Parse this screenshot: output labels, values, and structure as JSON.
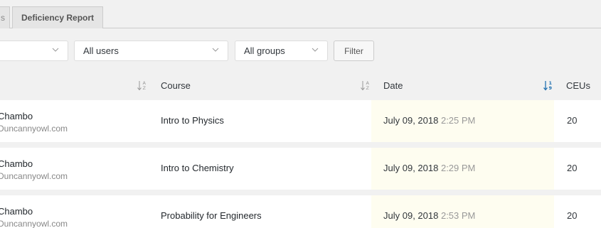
{
  "tabs": {
    "prev_label": "s",
    "deficiency_label": "Deficiency Report"
  },
  "filters": {
    "select1_value": "",
    "users_value": "All users",
    "groups_value": "All groups",
    "filter_button": "Filter"
  },
  "table": {
    "headers": {
      "course": "Course",
      "date": "Date",
      "ceus": "CEUs"
    },
    "rows": [
      {
        "name": "Chambo",
        "email": "Duncannyowl.com",
        "course": "Intro to Physics",
        "date": "July 09, 2018",
        "time": "2:25 PM",
        "ceus": "20"
      },
      {
        "name": "Chambo",
        "email": "Duncannyowl.com",
        "course": "Intro to Chemistry",
        "date": "July 09, 2018",
        "time": "2:29 PM",
        "ceus": "20"
      },
      {
        "name": "Chambo",
        "email": "Duncannyowl.com",
        "course": "Probability for Engineers",
        "date": "July 09, 2018",
        "time": "2:53 PM",
        "ceus": "20"
      }
    ]
  },
  "colors": {
    "page_bg": "#f1f1f1",
    "row_bg": "#ffffff",
    "date_highlight": "#fefdf0",
    "active_sort": "#2271b1"
  },
  "icons": {
    "sort_inactive": "sort-alpha-icon",
    "sort_active": "sort-numeric-icon",
    "dropdown": "chevron-down-icon"
  }
}
